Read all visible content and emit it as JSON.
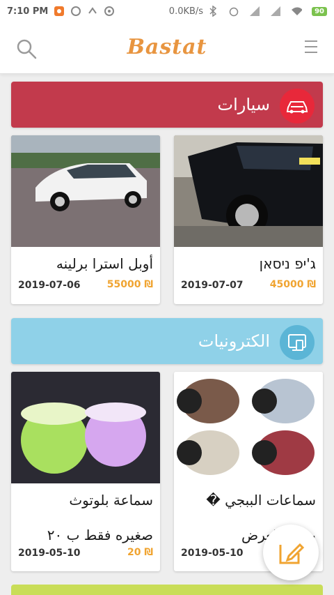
{
  "status_bar": {
    "time": "7:10 PM",
    "network_speed": "0.0KB/s",
    "battery": "90"
  },
  "header": {
    "logo": "Bastat",
    "search_icon": "search-icon",
    "menu_icon": "hamburger-menu-icon"
  },
  "categories": [
    {
      "label": "سيارات",
      "icon": "car-icon",
      "color": "#c23a4c",
      "icon_bg": "#e8283a",
      "items": [
        {
          "title": "ג'יפ ניסאן",
          "price": "45000",
          "currency": "₪",
          "date": "2019-07-07"
        },
        {
          "title": "أوبل استرا برلينه",
          "price": "55000",
          "currency": "₪",
          "date": "2019-07-06"
        }
      ]
    },
    {
      "label": "الكترونيات",
      "icon": "electronics-icon",
      "color": "#8fd1e8",
      "icon_bg": "#5bb5d6",
      "items": [
        {
          "title": "سماعات الببجي �",
          "title_line2": "بسعر العرض",
          "price": "",
          "currency": "",
          "date": "2019-05-10"
        },
        {
          "title": "سماعة بلوتوث",
          "title_line2": "صغيره فقط ب ٢٠",
          "price": "20",
          "currency": "₪",
          "date": "2019-05-10"
        }
      ]
    }
  ],
  "fab": {
    "icon": "edit-icon"
  }
}
